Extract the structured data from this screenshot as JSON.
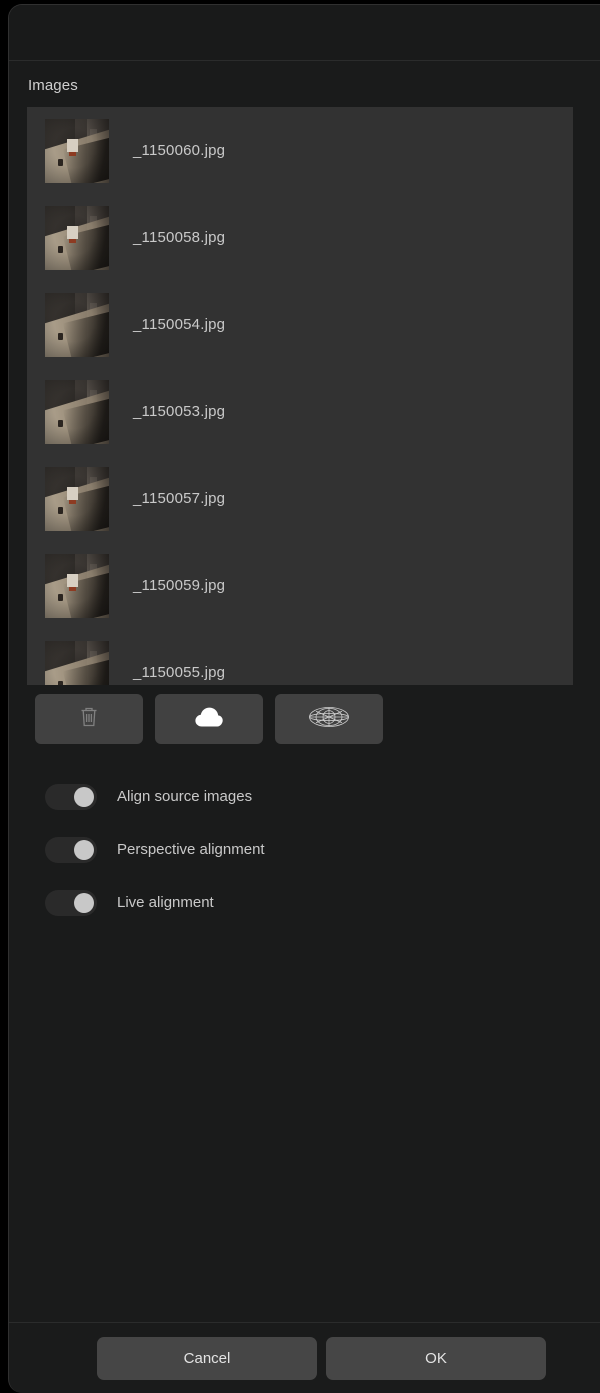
{
  "dialog": {
    "title": "",
    "section_label": "Images"
  },
  "image_list": {
    "items": [
      {
        "name": "_1150060.jpg",
        "thumbnail": "street-scene-thumbnail"
      },
      {
        "name": "_1150058.jpg",
        "thumbnail": "street-scene-thumbnail"
      },
      {
        "name": "_1150054.jpg",
        "thumbnail": "street-scene-thumbnail"
      },
      {
        "name": "_1150053.jpg",
        "thumbnail": "street-scene-thumbnail"
      },
      {
        "name": "_1150057.jpg",
        "thumbnail": "street-scene-thumbnail"
      },
      {
        "name": "_1150059.jpg",
        "thumbnail": "street-scene-thumbnail"
      },
      {
        "name": "_1150055.jpg",
        "thumbnail": "street-scene-thumbnail"
      }
    ]
  },
  "toolbar": {
    "buttons": [
      {
        "icon": "trash-icon",
        "label": "Remove",
        "enabled": false
      },
      {
        "icon": "cloud-icon",
        "label": "Cloud",
        "enabled": true
      },
      {
        "icon": "panorama-sphere-icon",
        "label": "Panorama",
        "enabled": true
      }
    ]
  },
  "options": [
    {
      "label": "Align source images",
      "state": "on"
    },
    {
      "label": "Perspective alignment",
      "state": "on"
    },
    {
      "label": "Live alignment",
      "state": "on"
    }
  ],
  "footer": {
    "cancel_label": "Cancel",
    "ok_label": "OK"
  },
  "colors": {
    "dialog_background": "#1a1b1b",
    "list_background": "#323232",
    "button_background": "#414141",
    "footer_button_background": "#464646",
    "text_primary": "#c9c9c9",
    "toggle_knob": "#c8c8c8",
    "toggle_track": "#2a2a2a"
  }
}
